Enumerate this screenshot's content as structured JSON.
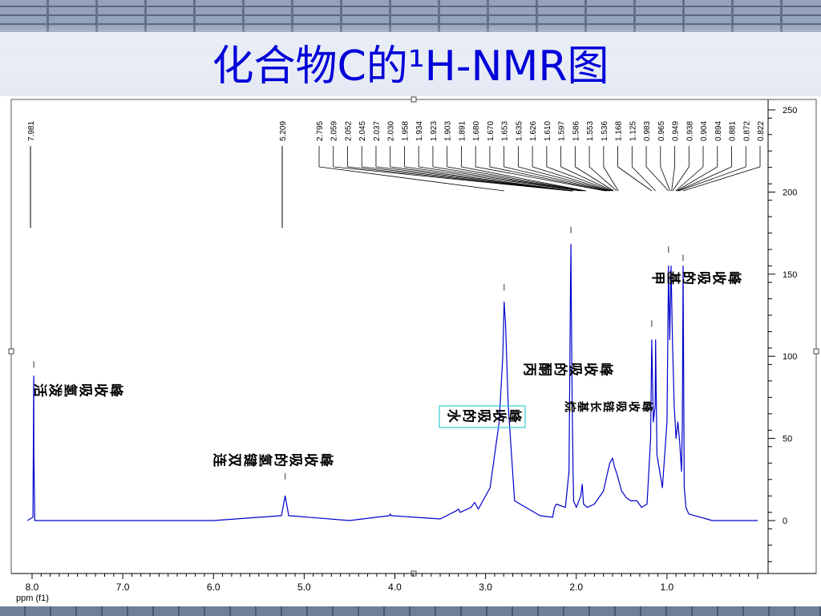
{
  "page_title": "化合物C的¹H-NMR图",
  "chart_data": {
    "type": "line",
    "title": "化合物C的¹H-NMR图",
    "xlabel": "ppm (f1)",
    "ylabel": "",
    "xlim": [
      8.05,
      0.0
    ],
    "ylim": [
      -30,
      255
    ],
    "x_ticks": [
      8.0,
      7.0,
      6.0,
      5.0,
      4.0,
      3.0,
      2.0,
      1.0
    ],
    "x_tick_labels": [
      "8.0",
      "7.0",
      "6.0",
      "5.0",
      "4.0",
      "3.0",
      "2.0",
      "1.0"
    ],
    "y_ticks": [
      0,
      50,
      100,
      150,
      200,
      250
    ],
    "y_tick_labels": [
      "0",
      "50",
      "100",
      "150",
      "200",
      "250"
    ],
    "grid": false,
    "line_color": "#0000cc",
    "series": [
      {
        "x": [
          8.05,
          7.99,
          7.982,
          7.981,
          7.98,
          7.97,
          7.0,
          6.0,
          5.25,
          5.22,
          5.209,
          5.2,
          5.17,
          4.5,
          4.06,
          4.05,
          4.04,
          3.5,
          3.32,
          3.3,
          3.28,
          3.16,
          3.12,
          3.08,
          2.95,
          2.85,
          2.81,
          2.795,
          2.78,
          2.75,
          2.68,
          2.4,
          2.26,
          2.24,
          2.22,
          2.12,
          2.08,
          2.064,
          2.059,
          2.054,
          2.045,
          2.035,
          2.03,
          2.0,
          1.95,
          1.934,
          1.92,
          1.88,
          1.8,
          1.7,
          1.66,
          1.63,
          1.6,
          1.58,
          1.55,
          1.5,
          1.45,
          1.4,
          1.33,
          1.28,
          1.22,
          1.18,
          1.168,
          1.15,
          1.13,
          1.125,
          1.11,
          1.05,
          1.0,
          0.983,
          0.97,
          0.955,
          0.94,
          0.92,
          0.9,
          0.88,
          0.86,
          0.84,
          0.83,
          0.822,
          0.81,
          0.79,
          0.76,
          0.5,
          0.0
        ],
        "y": [
          0,
          2,
          85,
          88,
          40,
          0,
          0,
          0,
          3,
          12,
          15,
          12,
          3,
          0,
          3,
          4,
          3,
          1,
          6,
          7,
          5,
          8,
          11,
          7,
          20,
          60,
          100,
          133,
          120,
          70,
          12,
          3,
          2,
          8,
          10,
          8,
          30,
          140,
          168,
          130,
          70,
          30,
          12,
          8,
          15,
          22,
          10,
          8,
          10,
          18,
          28,
          35,
          38,
          33,
          28,
          18,
          14,
          12,
          12,
          8,
          10,
          50,
          110,
          60,
          70,
          110,
          40,
          20,
          60,
          155,
          110,
          155,
          110,
          70,
          50,
          60,
          48,
          30,
          60,
          155,
          20,
          8,
          4,
          0,
          0
        ]
      }
    ],
    "peak_labels": [
      "7.981",
      "5.209",
      "2.795",
      "2.059",
      "2.052",
      "2.045",
      "2.037",
      "2.030",
      "1.958",
      "1.934",
      "1.923",
      "1.903",
      "1.891",
      "1.680",
      "1.670",
      "1.653",
      "1.635",
      "1.626",
      "1.610",
      "1.597",
      "1.586",
      "1.553",
      "1.536",
      "1.168",
      "1.125",
      "0.983",
      "0.965",
      "0.949",
      "0.938",
      "0.904",
      "0.894",
      "0.881",
      "0.872",
      "0.822"
    ],
    "annotations": [
      {
        "text": "活泼氢吸收峰",
        "x": 7.2,
        "y": 93
      },
      {
        "text": "连双键氢的吸收峰",
        "x": 5.3,
        "y": 42
      },
      {
        "text": "水的吸收峰",
        "x": 2.95,
        "y": 65
      },
      {
        "text": "丙酮的吸收峰",
        "x": 2.05,
        "y": 97
      },
      {
        "text": "烷基长链吸收峰",
        "x": 1.62,
        "y": 70
      },
      {
        "text": "甲基的吸收峰",
        "x": 0.9,
        "y": 150
      }
    ]
  }
}
